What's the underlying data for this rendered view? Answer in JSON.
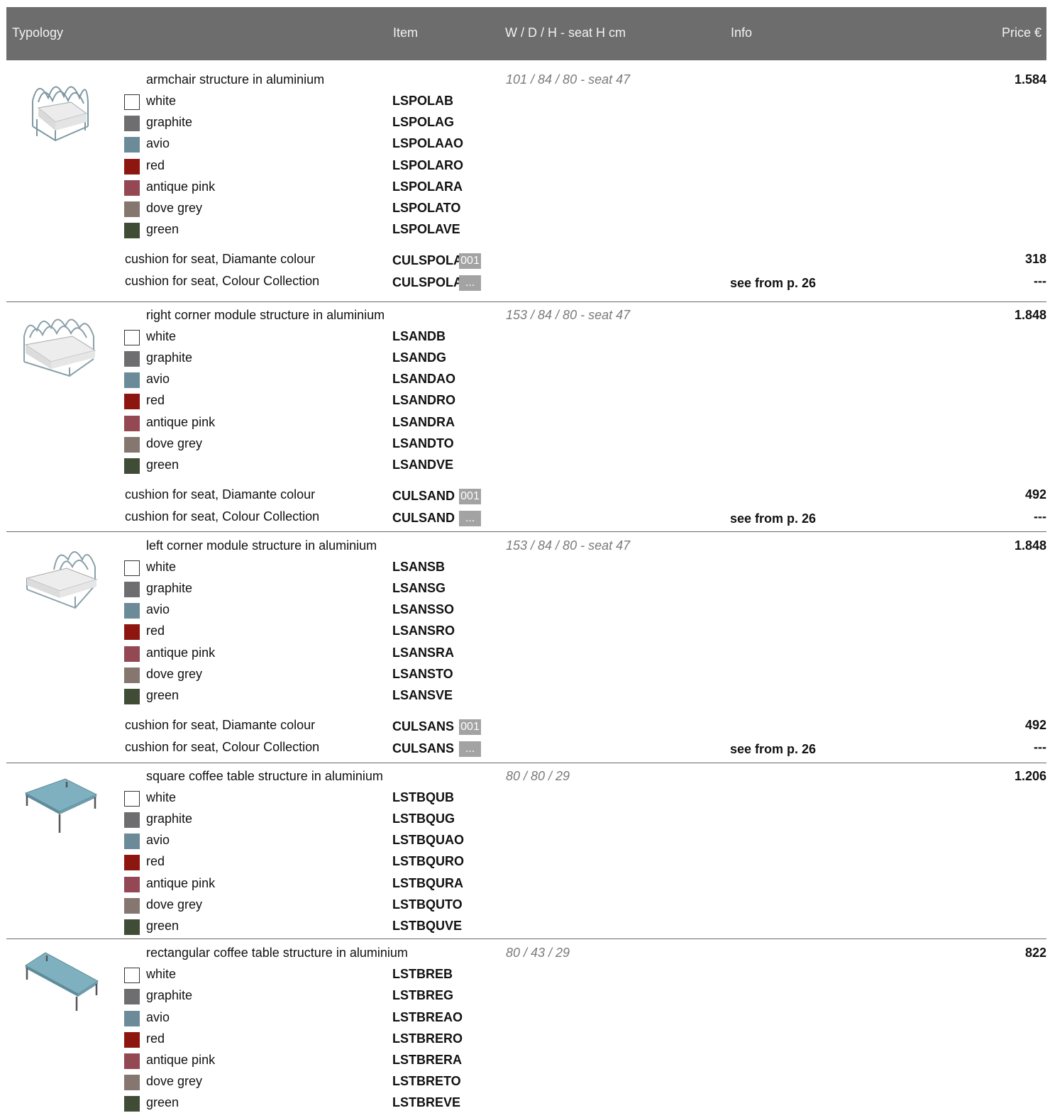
{
  "header": {
    "typology": "Typology",
    "item": "Item",
    "dimensions": "W / D / H - seat H cm",
    "info": "Info",
    "price": "Price €"
  },
  "colors": {
    "white": "#ffffff",
    "graphite": "#6e6e70",
    "avio": "#6b8b99",
    "red": "#8e1611",
    "antique_pink": "#944853",
    "dove_grey": "#85766f",
    "green": "#414c37"
  },
  "products": [
    {
      "title": "armchair structure in aluminium",
      "dimensions": "101 / 84 / 80 - seat 47",
      "price": "1.584",
      "image_icon": "armchair-icon",
      "variants": [
        {
          "color": "white",
          "code": "LSPOLAB"
        },
        {
          "color": "graphite",
          "code": "LSPOLAG"
        },
        {
          "color": "avio",
          "code": "LSPOLAAO"
        },
        {
          "color": "red",
          "code": "LSPOLARO"
        },
        {
          "color": "antique pink",
          "code": "LSPOLARA"
        },
        {
          "color": "dove grey",
          "code": "LSPOLATO"
        },
        {
          "color": "green",
          "code": "LSPOLAVE"
        }
      ],
      "cushions": [
        {
          "desc": "cushion for seat, Diamante colour",
          "code": "CULSPOLA",
          "tag": "001",
          "info": "",
          "price": "318"
        },
        {
          "desc": "cushion for seat, Colour Collection",
          "code": "CULSPOLA",
          "tag": "...",
          "info": "see from p. 26",
          "price": "---"
        }
      ]
    },
    {
      "title": "right corner module structure in aluminium",
      "dimensions": "153 / 84 / 80 - seat 47",
      "price": "1.848",
      "image_icon": "right-corner-module-icon",
      "variants": [
        {
          "color": "white",
          "code": "LSANDB"
        },
        {
          "color": "graphite",
          "code": "LSANDG"
        },
        {
          "color": "avio",
          "code": "LSANDAO"
        },
        {
          "color": "red",
          "code": "LSANDRO"
        },
        {
          "color": "antique pink",
          "code": "LSANDRA"
        },
        {
          "color": "dove grey",
          "code": "LSANDTO"
        },
        {
          "color": "green",
          "code": "LSANDVE"
        }
      ],
      "cushions": [
        {
          "desc": "cushion for seat, Diamante colour",
          "code": "CULSAND",
          "tag": "001",
          "info": "",
          "price": "492"
        },
        {
          "desc": "cushion for seat, Colour Collection",
          "code": "CULSAND",
          "tag": "...",
          "info": "see from p. 26",
          "price": "---"
        }
      ]
    },
    {
      "title": "left corner module structure in aluminium",
      "dimensions": "153 / 84 / 80 - seat 47",
      "price": "1.848",
      "image_icon": "left-corner-module-icon",
      "variants": [
        {
          "color": "white",
          "code": "LSANSB"
        },
        {
          "color": "graphite",
          "code": "LSANSG"
        },
        {
          "color": "avio",
          "code": "LSANSSO"
        },
        {
          "color": "red",
          "code": "LSANSRO"
        },
        {
          "color": "antique pink",
          "code": "LSANSRA"
        },
        {
          "color": "dove grey",
          "code": "LSANSTO"
        },
        {
          "color": "green",
          "code": "LSANSVE"
        }
      ],
      "cushions": [
        {
          "desc": "cushion for seat, Diamante colour",
          "code": "CULSANS",
          "tag": "001",
          "info": "",
          "price": "492"
        },
        {
          "desc": "cushion for seat, Colour Collection",
          "code": "CULSANS",
          "tag": "...",
          "info": "see from p. 26",
          "price": "---"
        }
      ]
    },
    {
      "title": "square coffee table structure in aluminium",
      "dimensions": "80 / 80 / 29",
      "price": "1.206",
      "image_icon": "square-table-icon",
      "variants": [
        {
          "color": "white",
          "code": "LSTBQUB"
        },
        {
          "color": "graphite",
          "code": "LSTBQUG"
        },
        {
          "color": "avio",
          "code": "LSTBQUAO"
        },
        {
          "color": "red",
          "code": "LSTBQURO"
        },
        {
          "color": "antique pink",
          "code": "LSTBQURA"
        },
        {
          "color": "dove grey",
          "code": "LSTBQUTO"
        },
        {
          "color": "green",
          "code": "LSTBQUVE"
        }
      ],
      "cushions": []
    },
    {
      "title": "rectangular coffee table structure in aluminium",
      "dimensions": "80 / 43 / 29",
      "price": "822",
      "image_icon": "rectangular-table-icon",
      "variants": [
        {
          "color": "white",
          "code": "LSTBREB"
        },
        {
          "color": "graphite",
          "code": "LSTBREG"
        },
        {
          "color": "avio",
          "code": "LSTBREAO"
        },
        {
          "color": "red",
          "code": "LSTBRERO"
        },
        {
          "color": "antique pink",
          "code": "LSTBRERA"
        },
        {
          "color": "dove grey",
          "code": "LSTBRETO"
        },
        {
          "color": "green",
          "code": "LSTBREVE"
        }
      ],
      "cushions": []
    }
  ]
}
